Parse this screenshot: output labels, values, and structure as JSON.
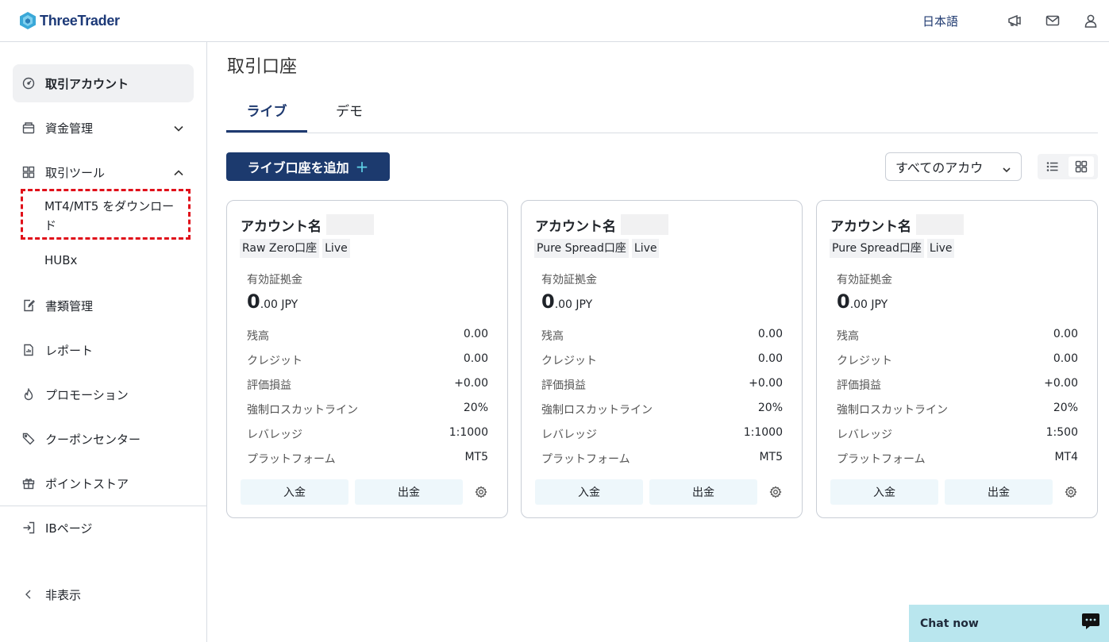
{
  "header": {
    "brand": "ThreeTrader",
    "language": "日本語",
    "icons": [
      "megaphone-icon",
      "mail-icon",
      "user-icon"
    ]
  },
  "sidebar": {
    "items": [
      {
        "label": "取引アカウント",
        "icon": "gauge-icon",
        "active": true
      },
      {
        "label": "資金管理",
        "icon": "wallet-icon",
        "expanded": false
      },
      {
        "label": "取引ツール",
        "icon": "grid-icon",
        "expanded": true
      },
      {
        "label": "書類管理",
        "icon": "document-edit-icon"
      },
      {
        "label": "レポート",
        "icon": "report-icon"
      },
      {
        "label": "プロモーション",
        "icon": "flame-icon"
      },
      {
        "label": "クーポンセンター",
        "icon": "ticket-icon"
      },
      {
        "label": "ポイントストア",
        "icon": "gift-icon"
      },
      {
        "label": "IBページ",
        "icon": "login-icon"
      },
      {
        "label": "非表示",
        "icon": "chevron-left-icon"
      }
    ],
    "sub_items": {
      "mt_download": "MT4/MT5 をダウンロード",
      "hubx": "HUBx"
    }
  },
  "main": {
    "title": "取引口座",
    "tabs": [
      {
        "label": "ライブ",
        "active": true
      },
      {
        "label": "デモ",
        "active": false
      }
    ],
    "add_button": "ライブ口座を追加",
    "add_button_plus": "+",
    "filter": {
      "value": "すべてのアカウ"
    },
    "view_modes": [
      "list-view-icon",
      "grid-view-icon"
    ]
  },
  "labels": {
    "account_name": "アカウント名",
    "equity": "有効証拠金",
    "balance": "残高",
    "credit": "クレジット",
    "floating_pl": "評価損益",
    "stop_out": "強制ロスカットライン",
    "leverage": "レバレッジ",
    "platform": "プラットフォーム",
    "deposit": "入金",
    "withdraw": "出金"
  },
  "accounts": [
    {
      "type": "Raw Zero口座",
      "status": "Live",
      "equity_int": "0",
      "equity_dec": ".00 JPY",
      "balance": "0.00",
      "credit": "0.00",
      "floating_pl": "+0.00",
      "stop_out": "20%",
      "leverage": "1:1000",
      "platform": "MT5"
    },
    {
      "type": "Pure Spread口座",
      "status": "Live",
      "equity_int": "0",
      "equity_dec": ".00 JPY",
      "balance": "0.00",
      "credit": "0.00",
      "floating_pl": "+0.00",
      "stop_out": "20%",
      "leverage": "1:1000",
      "platform": "MT5"
    },
    {
      "type": "Pure Spread口座",
      "status": "Live",
      "equity_int": "0",
      "equity_dec": ".00 JPY",
      "balance": "0.00",
      "credit": "0.00",
      "floating_pl": "+0.00",
      "stop_out": "20%",
      "leverage": "1:500",
      "platform": "MT4"
    }
  ],
  "chat": {
    "label": "Chat now"
  },
  "colors": {
    "brand": "#1c3a6e",
    "accent": "#5fd2e8",
    "highlight": "#e0101a",
    "chat_bg": "#b9e6ee"
  }
}
